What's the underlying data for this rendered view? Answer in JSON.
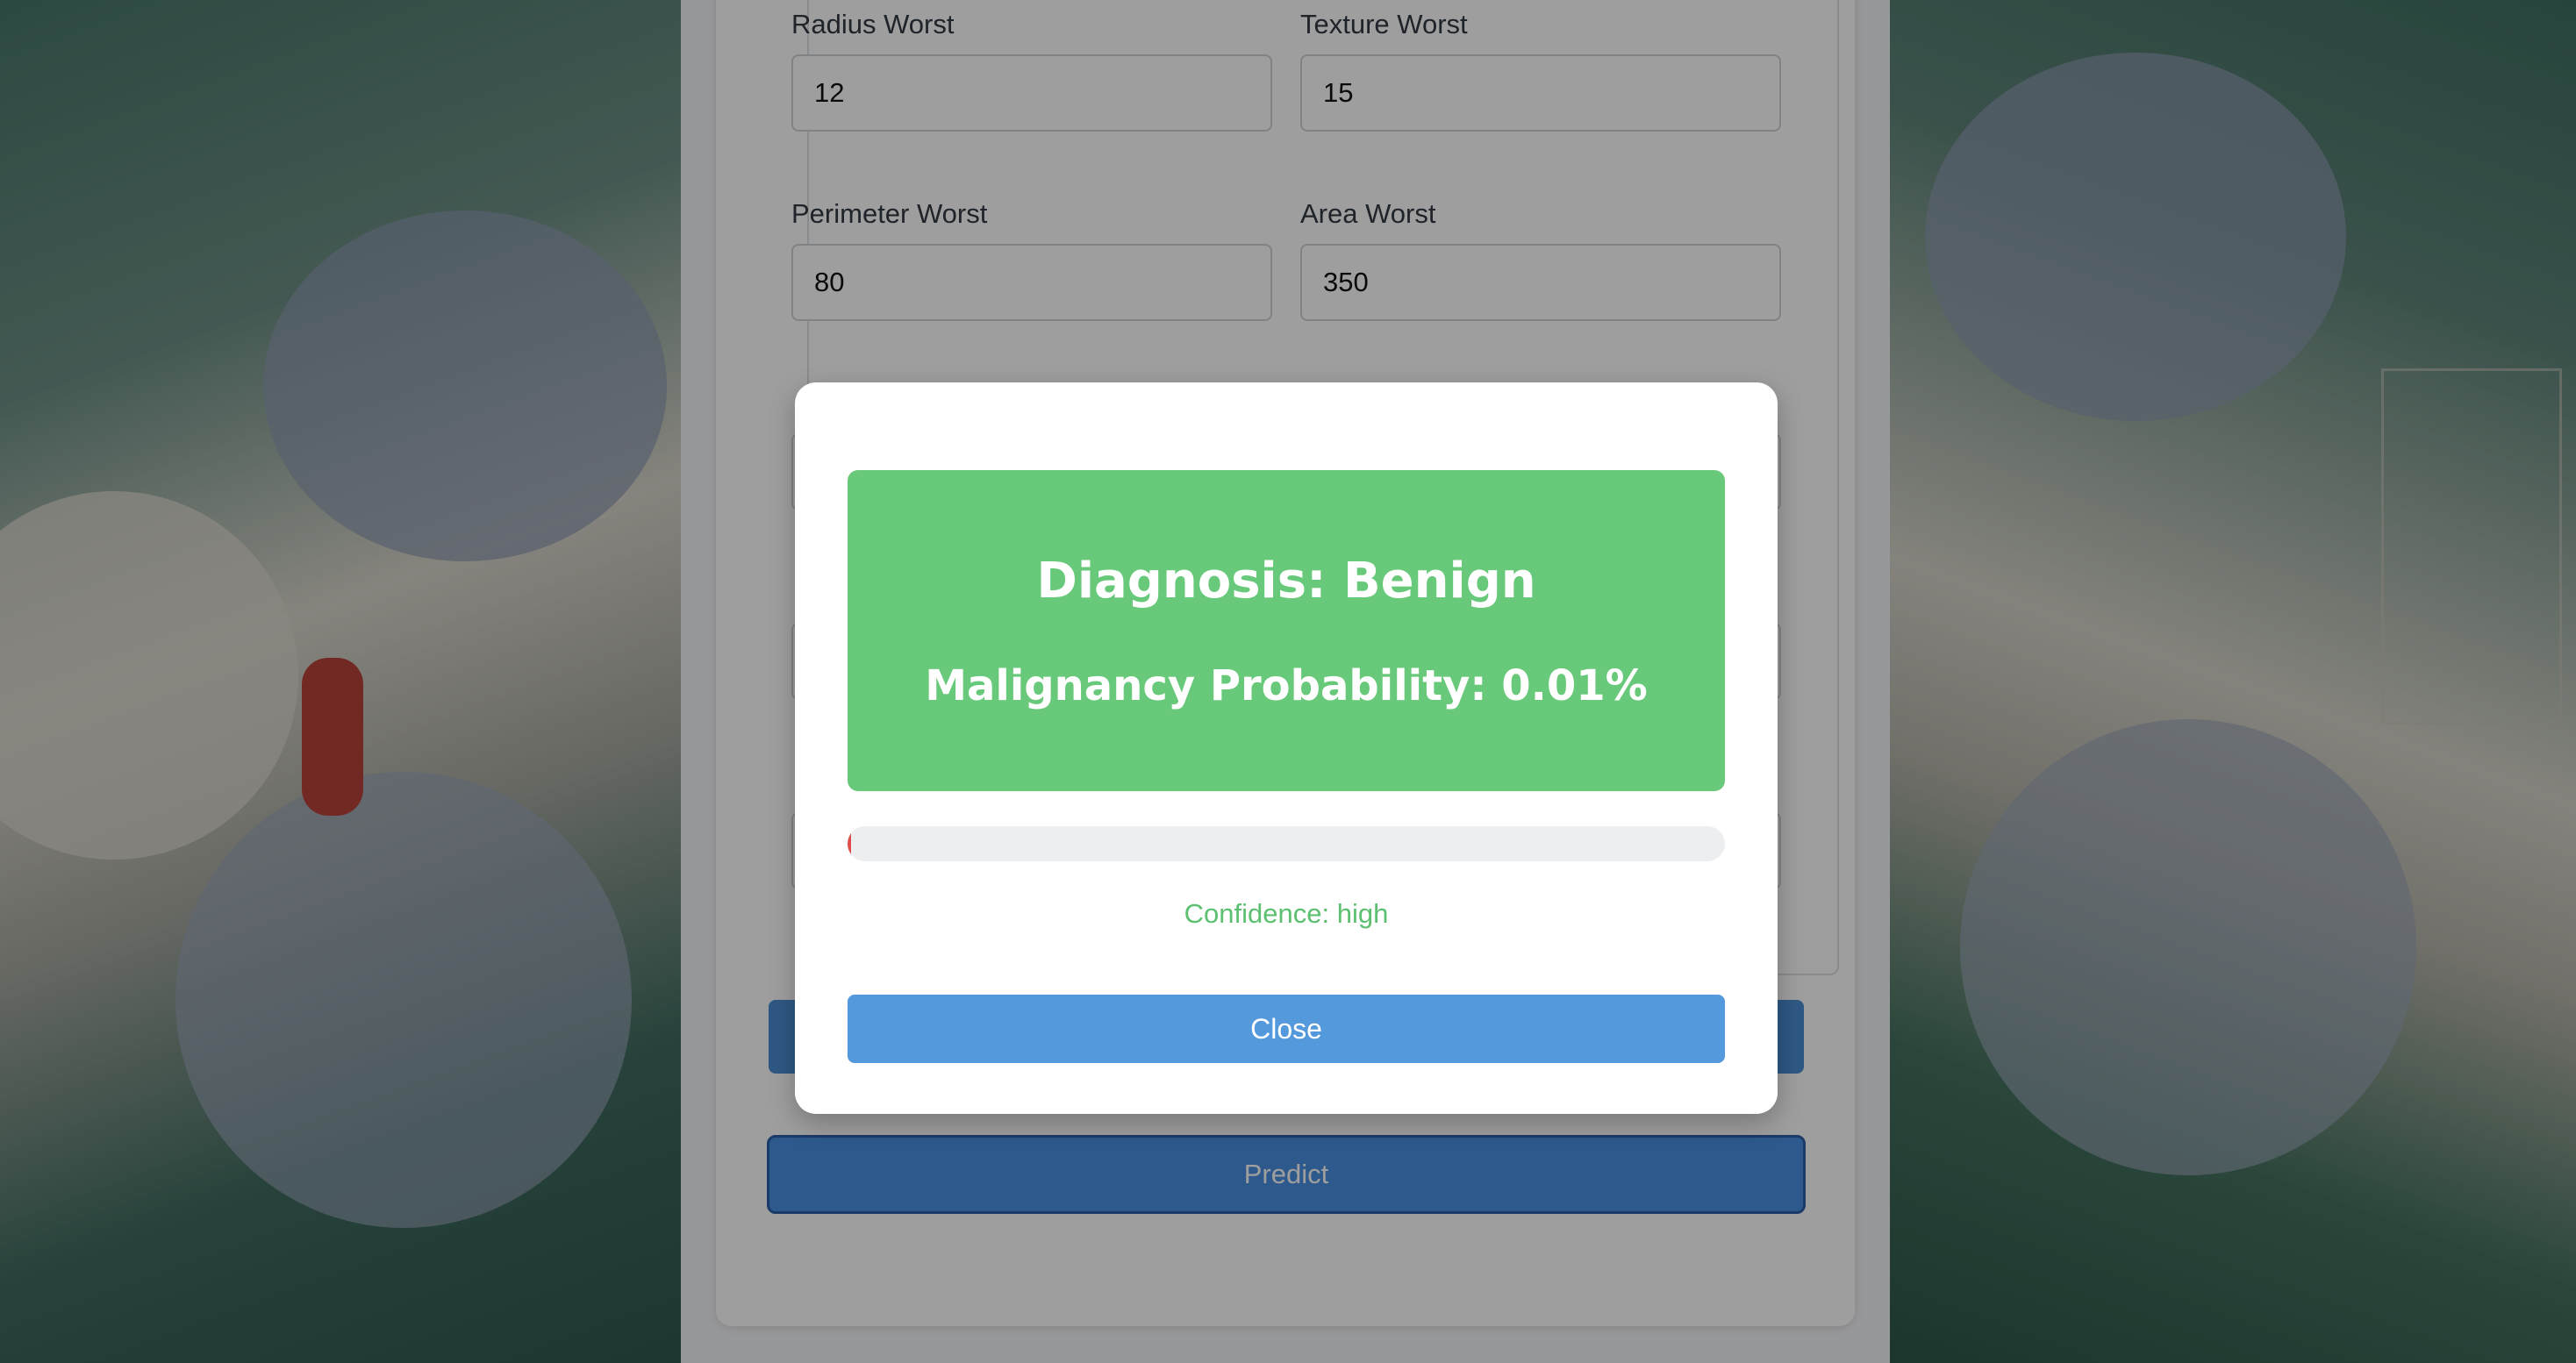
{
  "form": {
    "fields": [
      {
        "label": "Radius Worst",
        "value": "12"
      },
      {
        "label": "Texture Worst",
        "value": "15"
      },
      {
        "label": "Perimeter Worst",
        "value": "80"
      },
      {
        "label": "Area Worst",
        "value": "350"
      }
    ],
    "predict_label": "Predict"
  },
  "modal": {
    "diagnosis": "Diagnosis: Benign",
    "probability_text": "Malignancy Probability: 0.01%",
    "probability_value": 0.01,
    "confidence": "Confidence: high",
    "close_label": "Close",
    "result_color": "#68c97a",
    "bar_color": "#e14c4c",
    "confidence_color": "#5cc070"
  }
}
